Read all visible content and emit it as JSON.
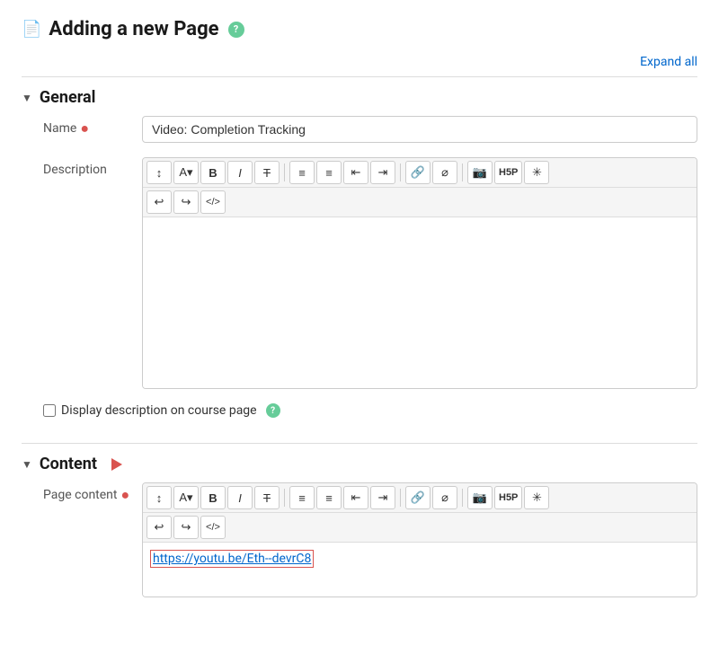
{
  "page": {
    "title": "Adding a new Page",
    "help_label": "?",
    "icon": "📄"
  },
  "expand_all": {
    "label": "Expand all"
  },
  "general_section": {
    "label": "General",
    "chevron": "▼",
    "fields": {
      "name": {
        "label": "Name",
        "value": "Video: Completion Tracking",
        "placeholder": ""
      },
      "description": {
        "label": "Description"
      }
    },
    "checkbox": {
      "label": "Display description on course page",
      "checked": false
    }
  },
  "content_section": {
    "label": "Content",
    "chevron": "▼",
    "fields": {
      "page_content": {
        "label": "Page content",
        "link_text": "https://youtu.be/Eth--devrC8"
      }
    }
  },
  "toolbar": {
    "row1_buttons": [
      {
        "id": "format",
        "label": "↕"
      },
      {
        "id": "font",
        "label": "A▾"
      },
      {
        "id": "bold",
        "label": "B"
      },
      {
        "id": "italic",
        "label": "I"
      },
      {
        "id": "strikethrough",
        "label": "T̶"
      },
      {
        "id": "ul",
        "label": "≡"
      },
      {
        "id": "ol",
        "label": "≡"
      },
      {
        "id": "indent",
        "label": "⇤"
      },
      {
        "id": "outdent",
        "label": "⇥"
      },
      {
        "id": "link",
        "label": "🔗"
      },
      {
        "id": "unlink",
        "label": "⊘"
      },
      {
        "id": "image",
        "label": "🖼"
      },
      {
        "id": "hp",
        "label": "H5P"
      },
      {
        "id": "special",
        "label": "✳"
      }
    ],
    "row2_buttons": [
      {
        "id": "undo",
        "label": "↩"
      },
      {
        "id": "redo",
        "label": "↪"
      },
      {
        "id": "source",
        "label": "</>"
      }
    ]
  }
}
